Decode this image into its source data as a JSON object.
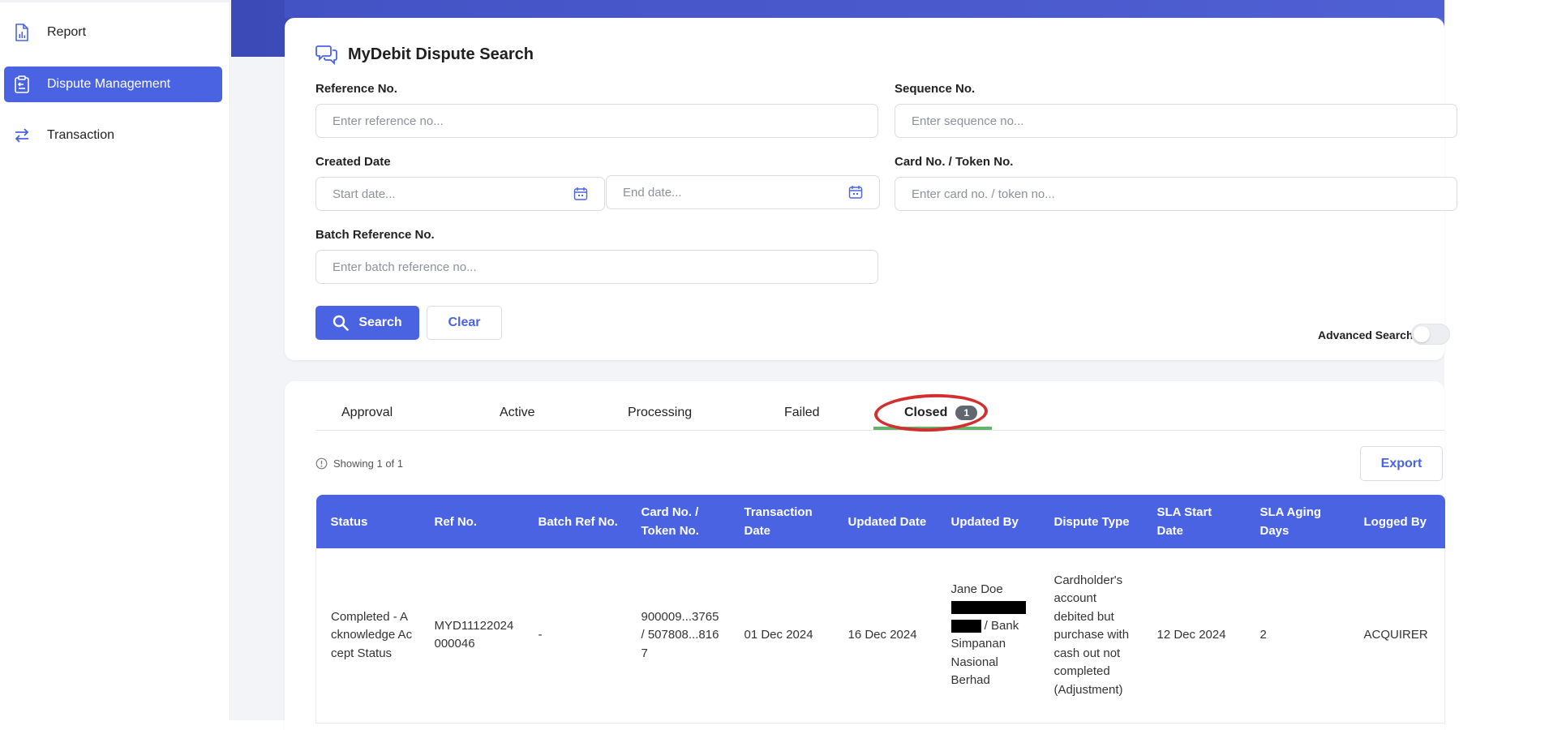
{
  "sidebar": {
    "items": [
      {
        "label": "Report",
        "icon": "report-icon"
      },
      {
        "label": "Dispute Management",
        "icon": "clipboard-icon",
        "active": true
      },
      {
        "label": "Transaction",
        "icon": "transfer-arrows-icon"
      }
    ]
  },
  "colors": {
    "accent": "#4a63e3",
    "banner": "#3b4ab6",
    "tab_underline": "#64b36b",
    "annotation": "#d32f2f"
  },
  "search": {
    "title": "MyDebit Dispute Search",
    "title_icon": "chat-bubbles-icon",
    "reference_label": "Reference No.",
    "reference_placeholder": "Enter reference no...",
    "sequence_label": "Sequence No.",
    "sequence_placeholder": "Enter sequence no...",
    "created_date_label": "Created Date",
    "start_date_placeholder": "Start date...",
    "end_date_placeholder": "End date...",
    "calendar_icon": "calendar-icon",
    "card_label": "Card No. / Token No.",
    "card_placeholder": "Enter card no. / token no...",
    "batch_label": "Batch Reference No.",
    "batch_placeholder": "Enter batch reference no...",
    "search_button": "Search",
    "search_icon": "search-icon",
    "clear_button": "Clear",
    "advanced_label": "Advanced Search",
    "advanced_enabled": false
  },
  "results": {
    "tabs": [
      {
        "label": "Approval"
      },
      {
        "label": "Active"
      },
      {
        "label": "Processing"
      },
      {
        "label": "Failed"
      },
      {
        "label": "Closed",
        "badge": "1",
        "active": true
      }
    ],
    "showing": "Showing 1 of 1",
    "info_icon": "info-icon",
    "export_button": "Export",
    "columns": [
      "Status",
      "Ref No.",
      "Batch Ref No.",
      "Card No. / Token No.",
      "Transaction Date",
      "Updated Date",
      "Updated By",
      "Dispute Type",
      "SLA Start Date",
      "SLA Aging Days",
      "Logged By"
    ],
    "rows": [
      {
        "status": "Completed - Acknowledge Accept Status",
        "ref_no": "MYD11122024000046",
        "batch_ref_no": "-",
        "card_no": "900009...3765 / 507808...8167",
        "transaction_date": "01 Dec 2024",
        "updated_date": "16 Dec 2024",
        "updated_by_name": "Jane Doe",
        "updated_by_org": "/ Bank Simpanan Nasional Berhad",
        "dispute_type": "Cardholder's account debited but purchase with cash out not completed (Adjustment)",
        "sla_start_date": "12 Dec 2024",
        "sla_aging_days": "2",
        "logged_by": "ACQUIRER"
      }
    ]
  }
}
